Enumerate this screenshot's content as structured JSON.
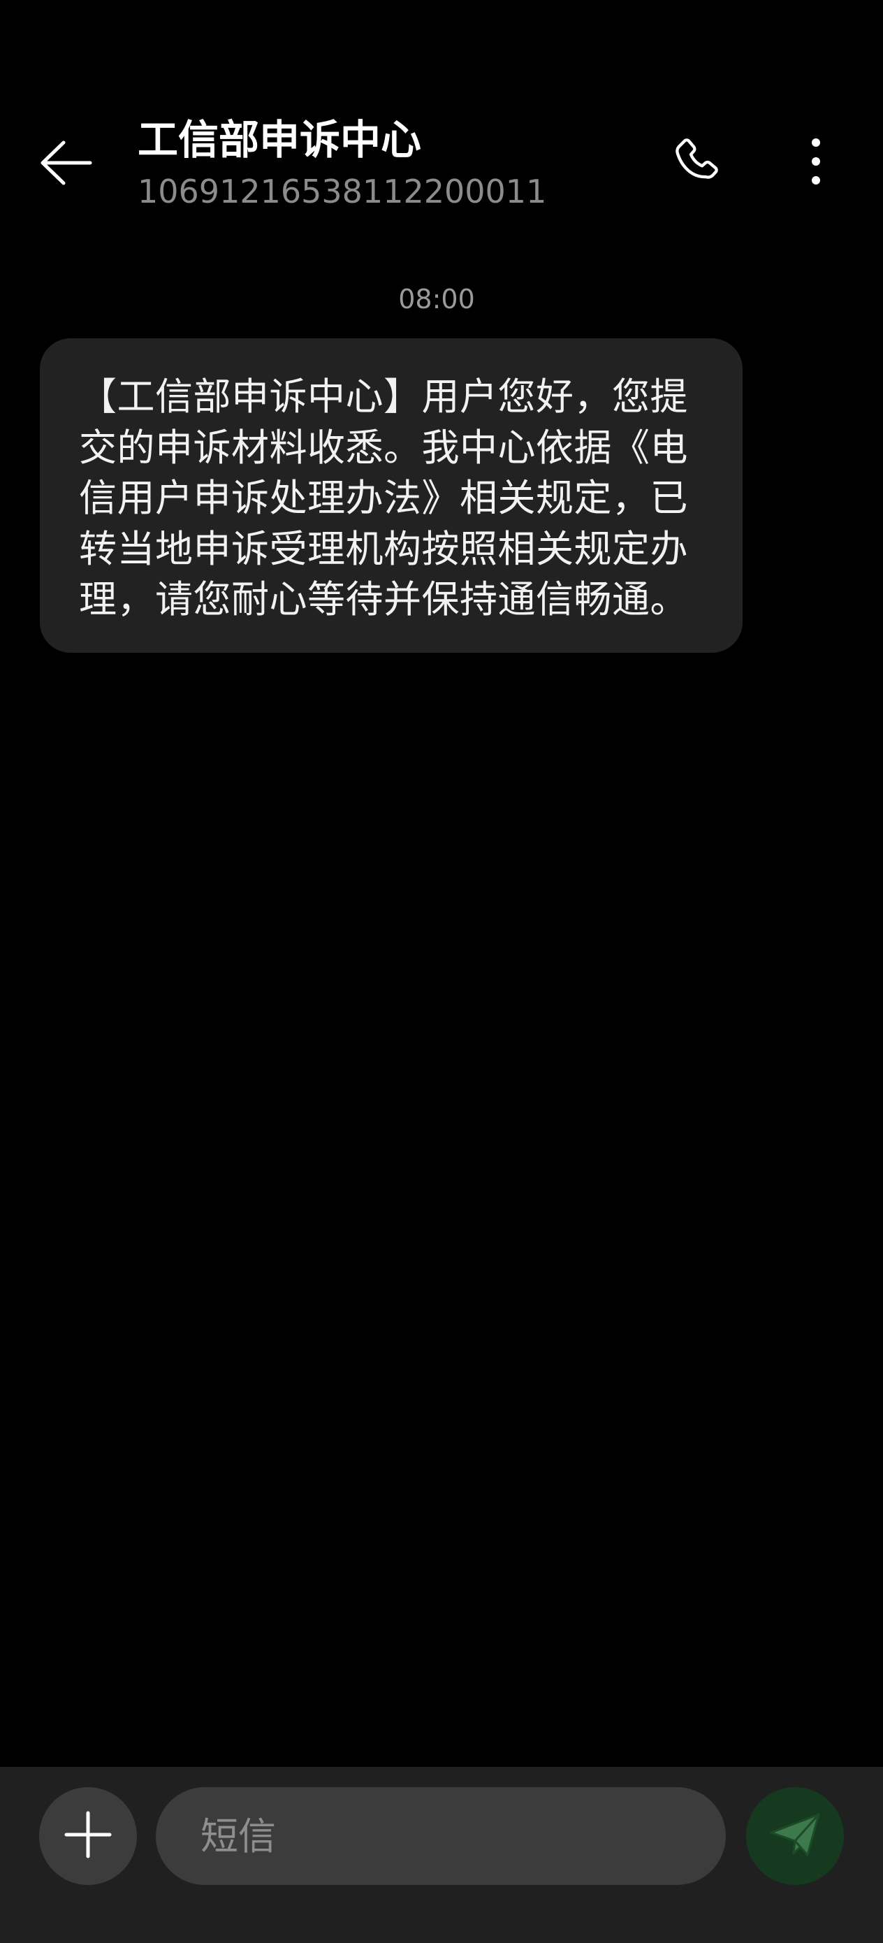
{
  "header": {
    "contact_name": "工信部申诉中心",
    "contact_number": "1069121653811220001​1",
    "back_icon": "arrow-left-icon",
    "call_icon": "phone-icon",
    "more_icon": "more-vertical-icon"
  },
  "conversation": {
    "messages": [
      {
        "time": "08:00",
        "direction": "incoming",
        "text": "【工信部申诉中心】用户您好，您提交的申诉材料收悉。我中心依据《电信用户申诉处理办法》相关规定，已转当地申诉受理机构按照相关规定办理，请您耐心等待并保持通信畅通。"
      }
    ]
  },
  "composer": {
    "add_icon": "plus-icon",
    "placeholder": "短信",
    "value": "",
    "send_icon": "send-icon"
  },
  "colors": {
    "background": "#000000",
    "bubble": "#222222",
    "compose_bar": "#202020",
    "input": "#3c3c3c",
    "send_button": "#163a1f",
    "send_icon": "#3d7a4b",
    "secondary_text": "#8c8c8c"
  }
}
